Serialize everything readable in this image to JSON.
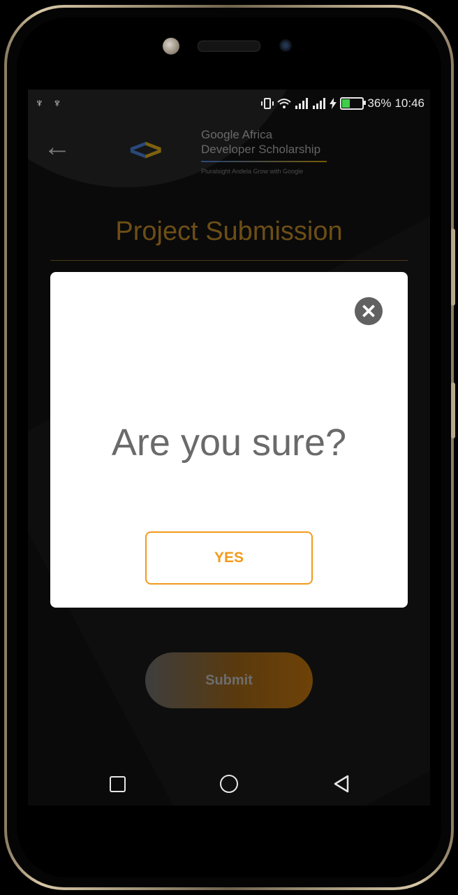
{
  "status_bar": {
    "left_icons": "♆ ♆",
    "battery_percent": "36%",
    "time": "10:46",
    "battery_level": 0.36,
    "battery_color": "#3ecf4a"
  },
  "header": {
    "back_icon": "arrow-left-icon",
    "logo": {
      "code_symbol": "<>",
      "title_line1": "Google Africa",
      "title_line2": "Developer Scholarship",
      "sub_line": "Pluralsight   Andela   Grow with Google"
    }
  },
  "page": {
    "title": "Project Submission",
    "submit_label": "Submit",
    "accent_color": "#f29a1c"
  },
  "dialog": {
    "close_icon": "close-icon",
    "message": "Are you sure?",
    "yes_label": "YES"
  },
  "nav_bar": {
    "recents_icon": "square-icon",
    "home_icon": "circle-icon",
    "back_icon": "triangle-back-icon"
  }
}
